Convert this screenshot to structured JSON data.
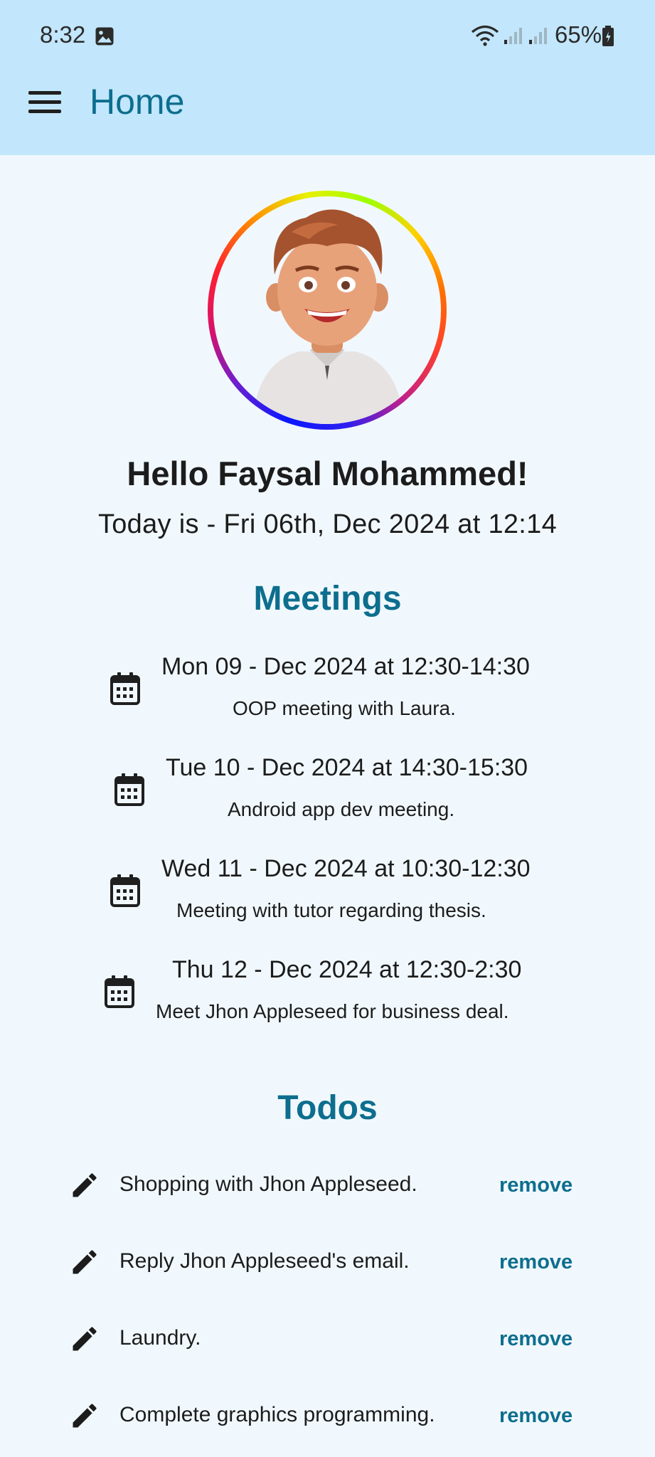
{
  "status_bar": {
    "time": "8:32",
    "battery": "65%",
    "icons": [
      "gallery-icon",
      "wifi-icon",
      "signal-icon",
      "signal-icon",
      "battery-icon"
    ]
  },
  "app_bar": {
    "title": "Home",
    "menu_icon": "menu-icon"
  },
  "profile": {
    "greeting": "Hello Faysal Mohammed!",
    "date_line": "Today is - Fri 06th, Dec 2024 at 12:14"
  },
  "meetings": {
    "title": "Meetings",
    "icon": "calendar-icon",
    "items": [
      {
        "when": "Mon 09 - Dec 2024 at 12:30-14:30",
        "desc": "OOP meeting with Laura."
      },
      {
        "when": "Tue 10 - Dec 2024 at 14:30-15:30",
        "desc": "Android app dev meeting."
      },
      {
        "when": "Wed 11 - Dec 2024 at 10:30-12:30",
        "desc": "Meeting with tutor regarding thesis."
      },
      {
        "when": "Thu 12 - Dec 2024 at 12:30-2:30",
        "desc": "Meet Jhon Appleseed for business deal."
      }
    ]
  },
  "todos": {
    "title": "Todos",
    "icon": "pencil-icon",
    "remove_label": "remove",
    "items": [
      {
        "text": "Shopping with Jhon Appleseed."
      },
      {
        "text": "Reply Jhon Appleseed's email."
      },
      {
        "text": "Laundry."
      },
      {
        "text": "Complete graphics programming."
      }
    ]
  },
  "colors": {
    "app_bar": "#c2e6fb",
    "background": "#f1f8fd",
    "accent": "#0d6e8e"
  }
}
